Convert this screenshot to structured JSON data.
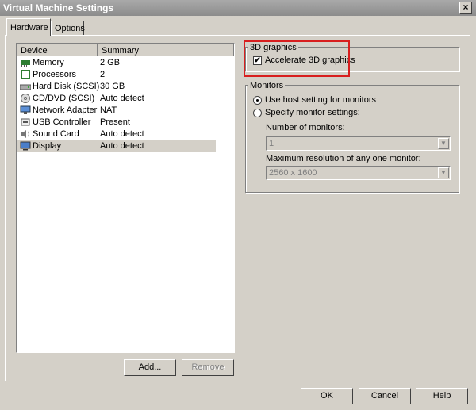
{
  "window": {
    "title": "Virtual Machine Settings",
    "close_glyph": "×"
  },
  "tabs": [
    {
      "label": "Hardware"
    },
    {
      "label": "Options"
    }
  ],
  "device_list": {
    "columns": [
      "Device",
      "Summary"
    ],
    "rows": [
      {
        "device": "Memory",
        "summary": "2 GB",
        "icon": "memory-icon"
      },
      {
        "device": "Processors",
        "summary": "2",
        "icon": "processor-icon"
      },
      {
        "device": "Hard Disk (SCSI)",
        "summary": "30 GB",
        "icon": "hard-disk-icon"
      },
      {
        "device": "CD/DVD (SCSI)",
        "summary": "Auto detect",
        "icon": "cd-dvd-icon"
      },
      {
        "device": "Network Adapter",
        "summary": "NAT",
        "icon": "network-adapter-icon"
      },
      {
        "device": "USB Controller",
        "summary": "Present",
        "icon": "usb-controller-icon"
      },
      {
        "device": "Sound Card",
        "summary": "Auto detect",
        "icon": "sound-card-icon"
      },
      {
        "device": "Display",
        "summary": "Auto detect",
        "icon": "display-icon",
        "selected": true
      }
    ],
    "add_label": "Add...",
    "remove_label": "Remove"
  },
  "graphics_3d": {
    "group_label": "3D graphics",
    "accelerate_label": "Accelerate 3D graphics",
    "accelerate_checked": true,
    "checkmark": "✔",
    "highlight_color": "#d81e1e"
  },
  "monitors": {
    "group_label": "Monitors",
    "option_host": "Use host setting for monitors",
    "option_specify": "Specify monitor settings:",
    "selected_option": "host",
    "num_monitors_label": "Number of monitors:",
    "num_monitors_value": "1",
    "max_res_label": "Maximum resolution of any one monitor:",
    "max_res_value": "2560 x 1600",
    "dropdown_arrow": "▼"
  },
  "footer": {
    "ok_label": "OK",
    "cancel_label": "Cancel",
    "help_label": "Help"
  }
}
